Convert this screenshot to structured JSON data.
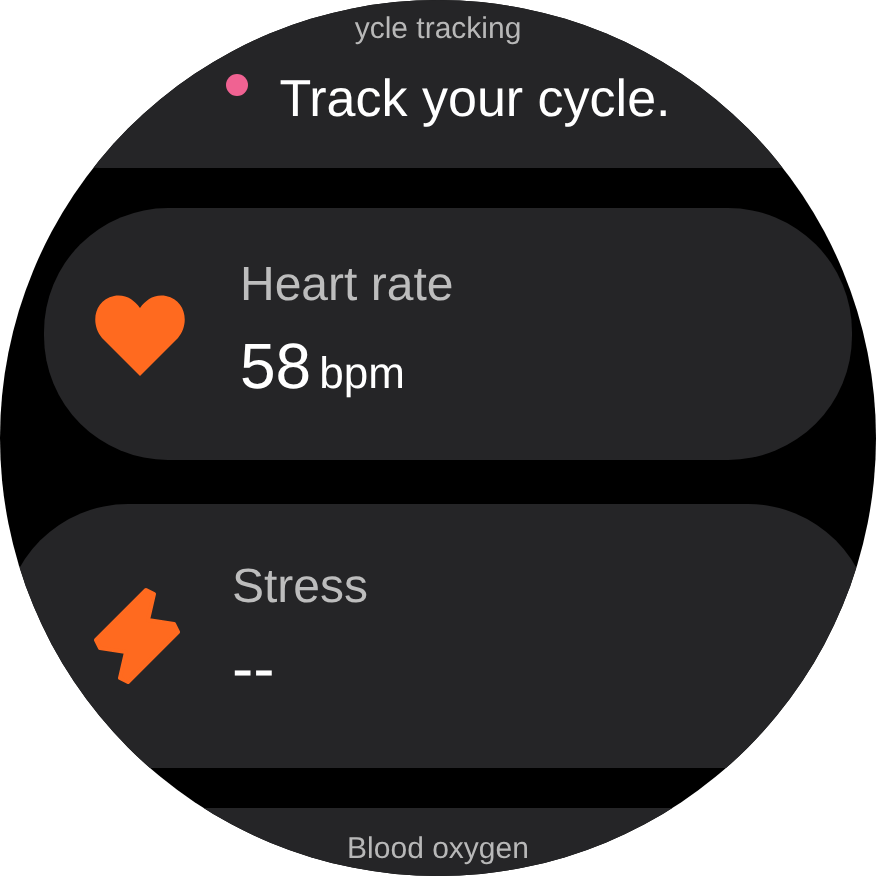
{
  "cards": [
    {
      "kind": "cycle",
      "title": "ycle tracking",
      "value": "Track your cycle.",
      "color": "#f06292"
    },
    {
      "kind": "heart",
      "title": "Heart rate",
      "value": "58",
      "unit": "bpm"
    },
    {
      "kind": "stress",
      "title": "Stress",
      "value": "--"
    },
    {
      "kind": "partial",
      "title": "Blood oxygen"
    }
  ]
}
